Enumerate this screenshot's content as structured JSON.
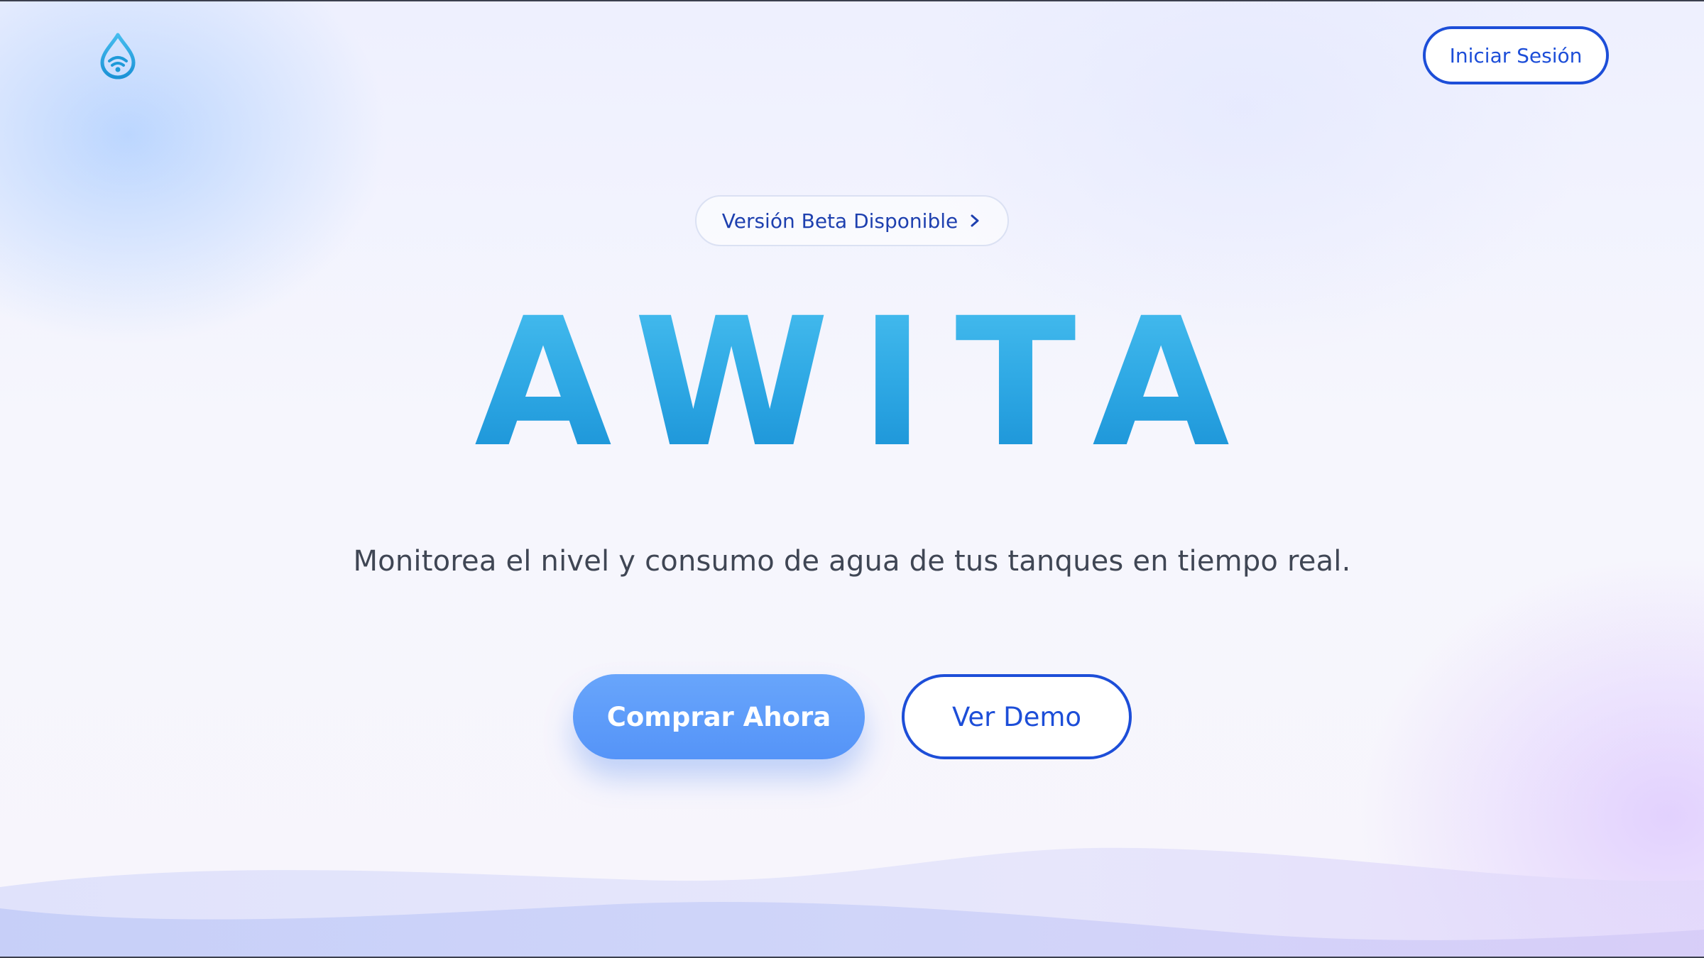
{
  "header": {
    "logo_icon": "water-drop-wifi-icon",
    "login_label": "Iniciar Sesión"
  },
  "hero": {
    "badge_label": "Versión Beta Disponible",
    "badge_icon": "chevron-right-icon",
    "title": "AWITA",
    "subtitle": "Monitorea el nivel y consumo de agua de tus tanques en tiempo real.",
    "primary_cta": "Comprar Ahora",
    "secondary_cta": "Ver Demo"
  },
  "colors": {
    "accent_blue": "#1d4ed8",
    "title_gradient_top": "#45bcee",
    "title_gradient_bottom": "#1a92d6",
    "primary_button": "#5f9cfa",
    "subtitle_text": "#3f4654"
  }
}
